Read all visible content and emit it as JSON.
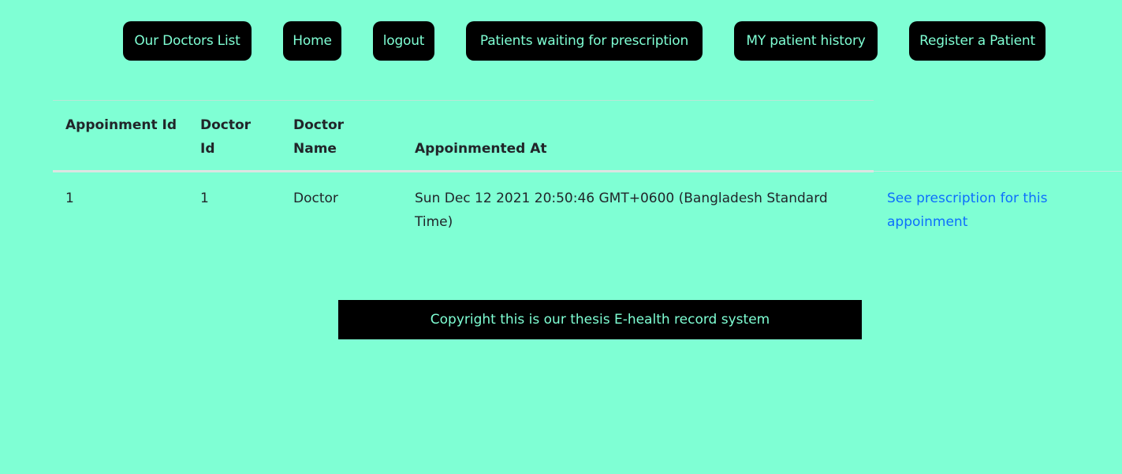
{
  "nav": {
    "doctors_list": "Our Doctors List",
    "home": "Home",
    "logout": "logout",
    "waiting": "Patients waiting for prescription",
    "history": "MY patient history",
    "register": "Register a Patient"
  },
  "table": {
    "headers": {
      "appointment_id": "Appoinment Id",
      "doctor_id": "Doctor Id",
      "doctor_name": "Doctor Name",
      "appointed_at": "Appoinmented At"
    },
    "rows": [
      {
        "appointment_id": "1",
        "doctor_id": "1",
        "doctor_name": "Doctor",
        "appointed_at": "Sun Dec 12 2021 20:50:46 GMT+0600 (Bangladesh Standard Time)",
        "action": "See prescription for this appoinment"
      }
    ]
  },
  "footer": {
    "text": "Copyright this is our thesis E-health record system"
  },
  "colors": {
    "background": "#7fffd4",
    "button_bg": "#000000",
    "button_text": "#7fffd4",
    "link": "#0d6efd"
  }
}
